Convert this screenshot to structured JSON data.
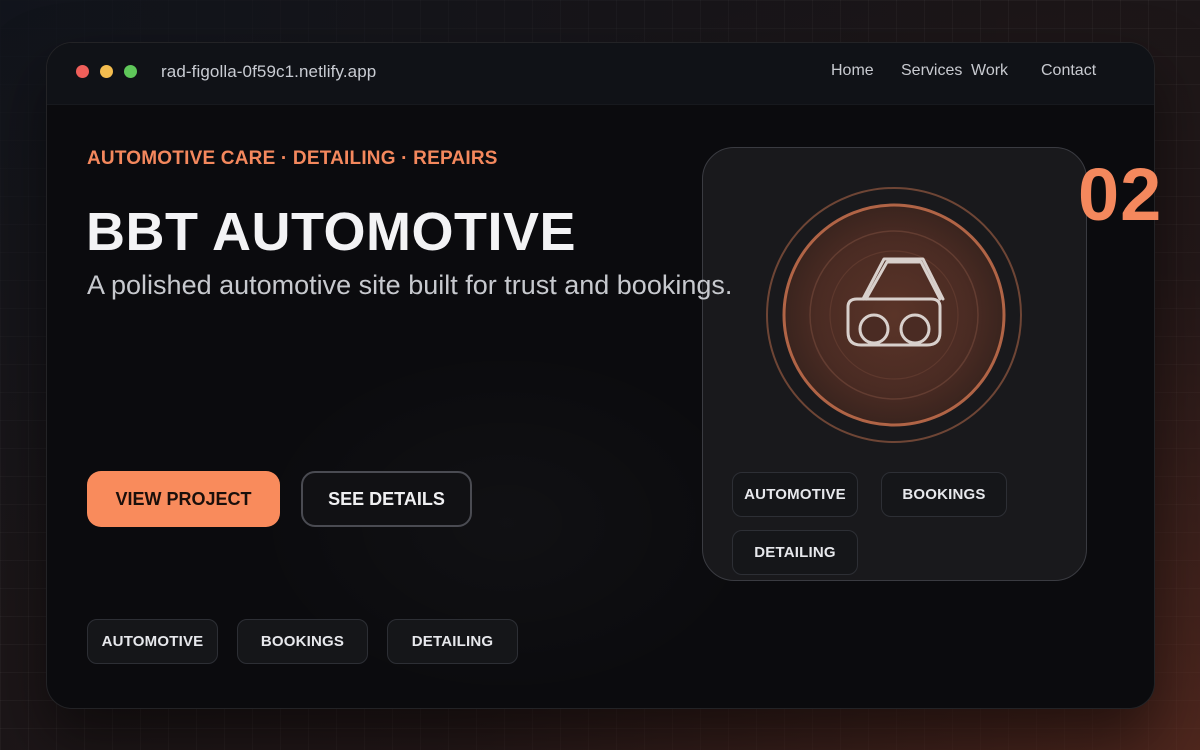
{
  "browser": {
    "url": "rad-figolla-0f59c1.netlify.app",
    "dots": [
      "close",
      "minimize",
      "maximize"
    ]
  },
  "nav": {
    "items": [
      "Home",
      "Services",
      "Work",
      "Contact"
    ]
  },
  "hero": {
    "eyebrow": "AUTOMOTIVE CARE · DETAILING · REPAIRS",
    "title": "BBT AUTOMOTIVE",
    "subtitle": "A polished automotive site built for trust and bookings.",
    "primary_button": "VIEW PROJECT",
    "secondary_button": "SEE DETAILS",
    "tags": [
      "AUTOMOTIVE",
      "BOOKINGS",
      "DETAILING"
    ]
  },
  "card": {
    "icon": "car-icon",
    "tags": [
      "AUTOMOTIVE",
      "BOOKINGS",
      "DETAILING"
    ]
  },
  "project_number": "02",
  "colors": {
    "accent": "#f4885d",
    "button_primary": "#f98b5c",
    "window_bg": "#0b0b0e",
    "card_bg": "#19191c",
    "emblem_ring": "#b5694a"
  }
}
